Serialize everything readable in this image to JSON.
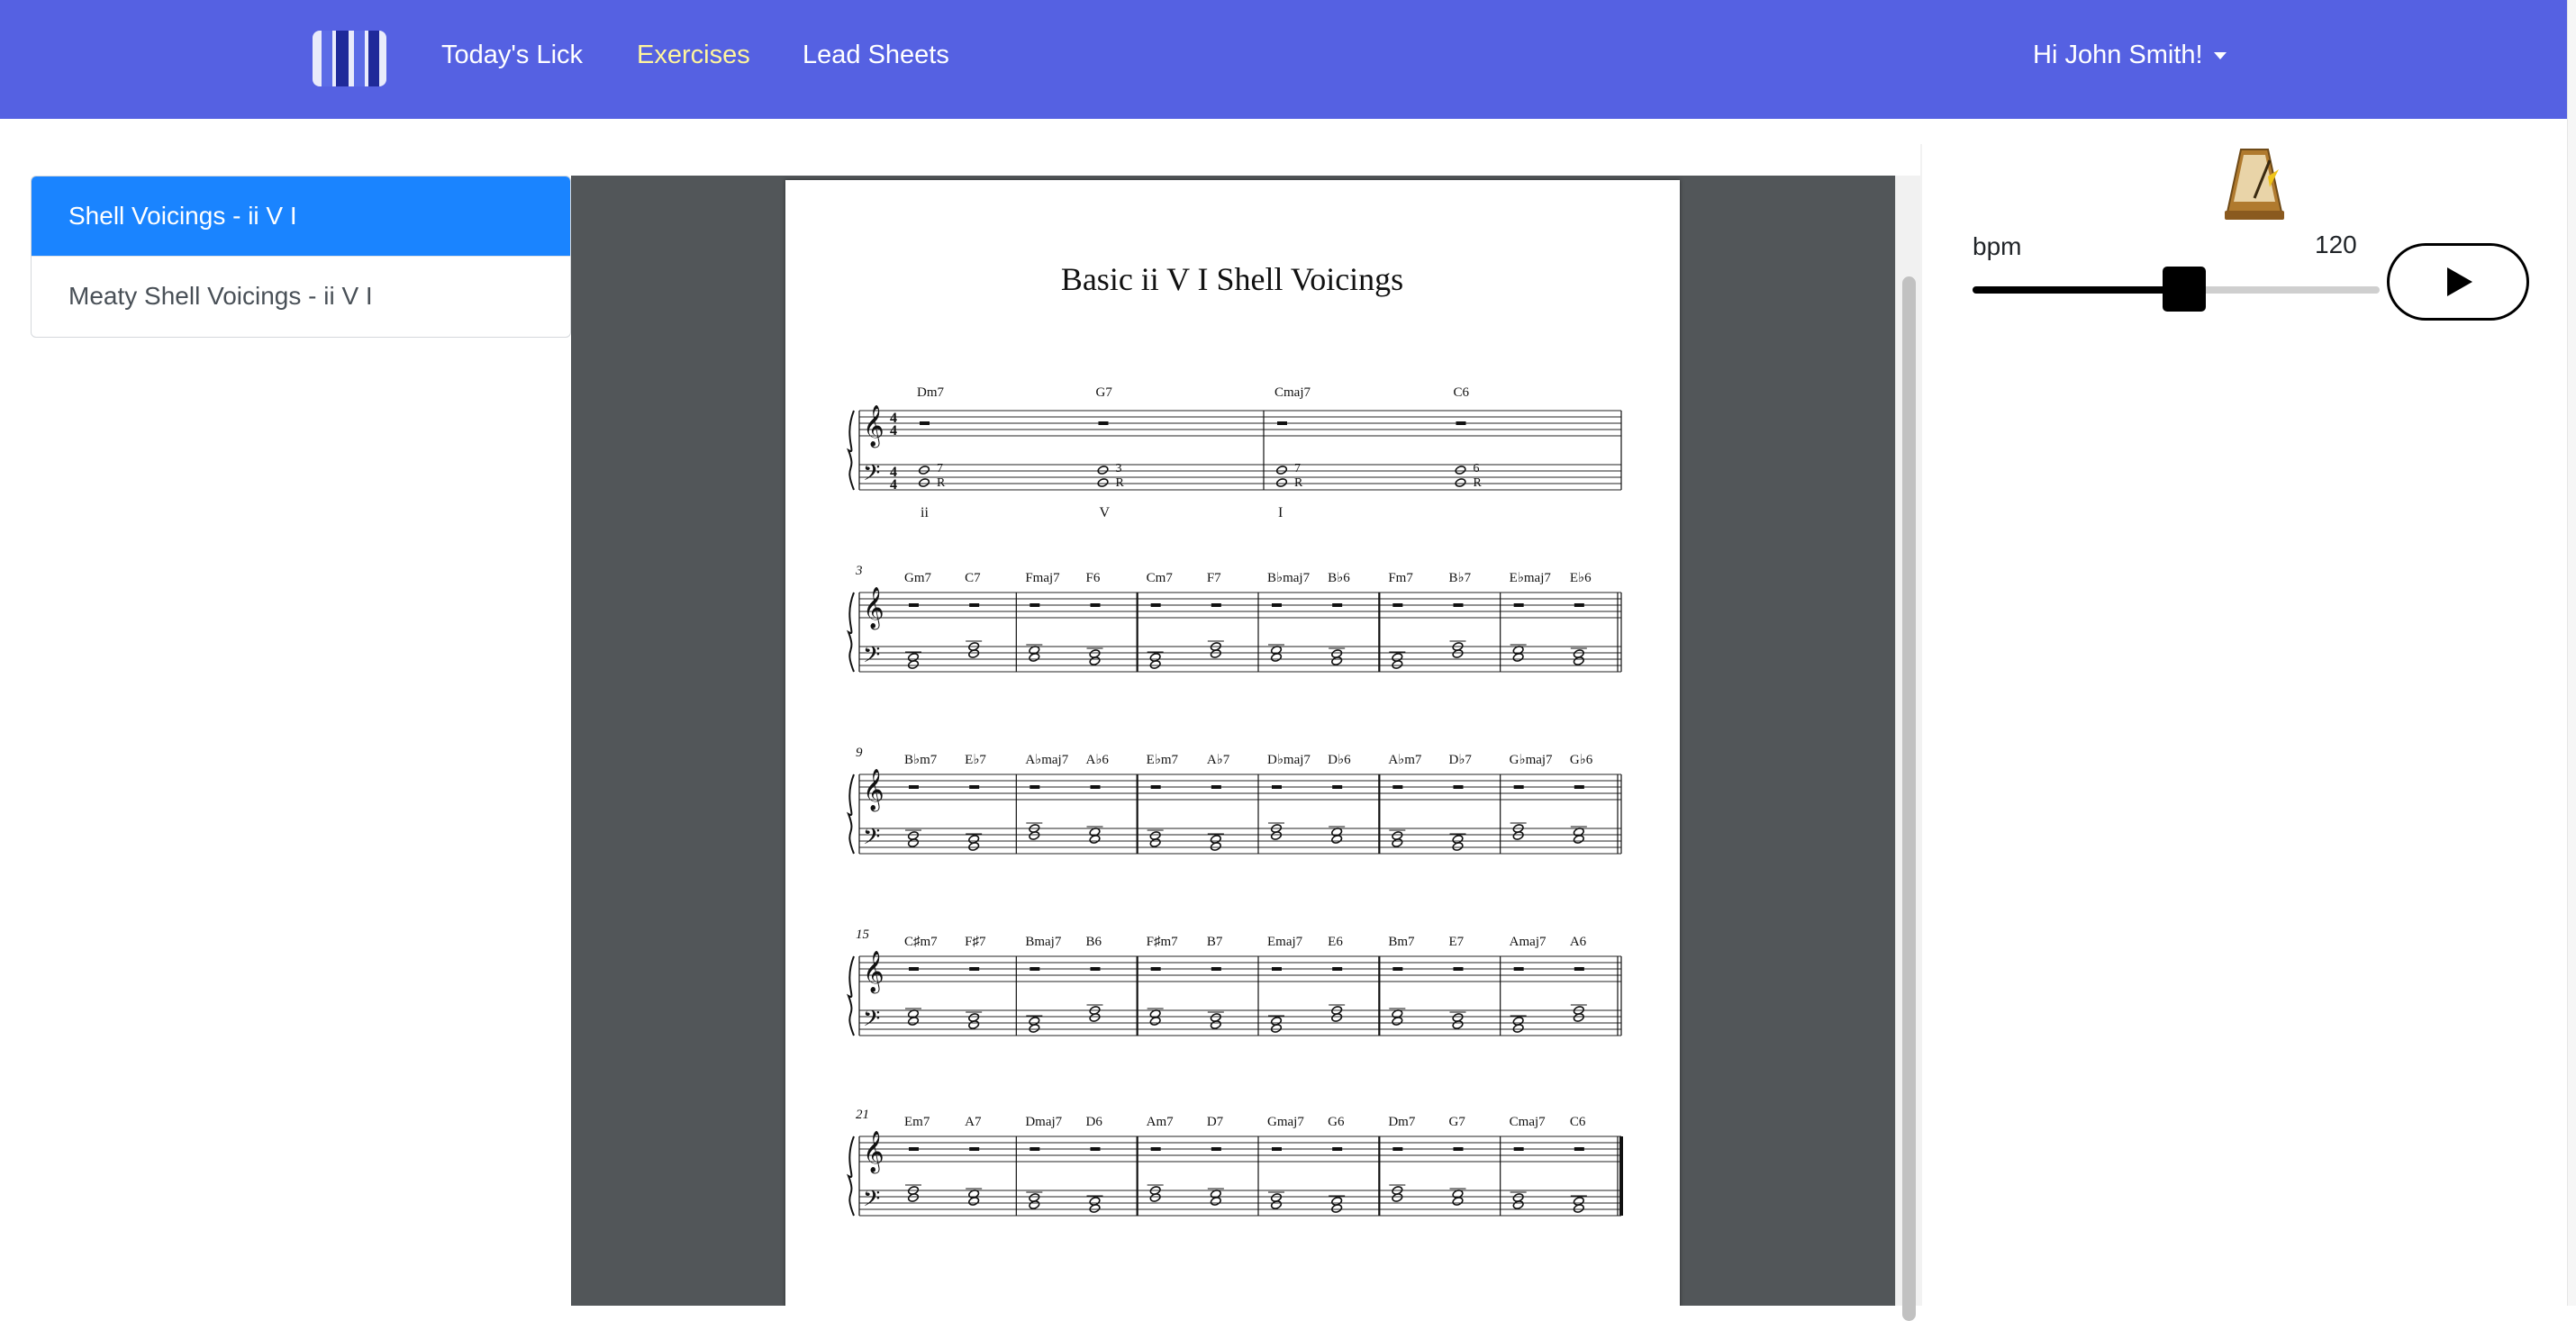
{
  "navbar": {
    "brand_icon": "piano-keys-icon",
    "links": [
      {
        "label": "Today's Lick",
        "active": false
      },
      {
        "label": "Exercises",
        "active": true
      },
      {
        "label": "Lead Sheets",
        "active": false
      }
    ],
    "user_greeting": "Hi John Smith!",
    "colors": {
      "bar": "#5561e2",
      "active_link": "#fff59d"
    }
  },
  "exercises": {
    "items": [
      {
        "label": "Shell Voicings - ii V I",
        "selected": true
      },
      {
        "label": "Meaty Shell Voicings - ii V I",
        "selected": false
      }
    ],
    "selected_color": "#1a84ff"
  },
  "sheet": {
    "title": "Basic ii V I Shell Voicings",
    "systems": [
      {
        "measure_number": "",
        "chords": [
          "Dm7",
          "G7",
          "Cmaj7",
          "C6"
        ],
        "roman_numerals": [
          "ii",
          "V",
          "I"
        ],
        "voicing_labels": [
          "7",
          "R",
          "3",
          "R",
          "7",
          "R",
          "6",
          "R"
        ]
      },
      {
        "measure_number": "3",
        "chords": [
          "Gm7",
          "C7",
          "Fmaj7",
          "F6",
          "Cm7",
          "F7",
          "B♭maj7",
          "B♭6",
          "Fm7",
          "B♭7",
          "E♭maj7",
          "E♭6"
        ]
      },
      {
        "measure_number": "9",
        "chords": [
          "B♭m7",
          "E♭7",
          "A♭maj7",
          "A♭6",
          "E♭m7",
          "A♭7",
          "D♭maj7",
          "D♭6",
          "A♭m7",
          "D♭7",
          "G♭maj7",
          "G♭6"
        ]
      },
      {
        "measure_number": "15",
        "chords": [
          "C♯m7",
          "F♯7",
          "Bmaj7",
          "B6",
          "F♯m7",
          "B7",
          "Emaj7",
          "E6",
          "Bm7",
          "E7",
          "Amaj7",
          "A6"
        ]
      },
      {
        "measure_number": "21",
        "chords": [
          "Em7",
          "A7",
          "Dmaj7",
          "D6",
          "Am7",
          "D7",
          "Gmaj7",
          "G6",
          "Dm7",
          "G7",
          "Cmaj7",
          "C6"
        ]
      }
    ]
  },
  "player": {
    "metronome_icon": "metronome-icon",
    "bpm_label": "bpm",
    "bpm": "120",
    "tempo_fraction": 0.52,
    "play_icon": "play-icon"
  }
}
